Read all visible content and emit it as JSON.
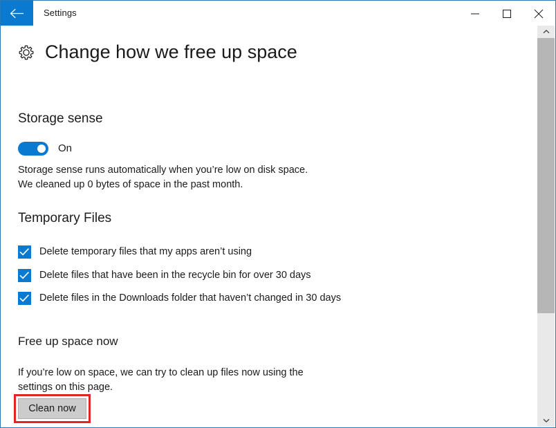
{
  "window": {
    "title": "Settings",
    "accent_color": "#0a7ad0",
    "border_color": "#2a79b5",
    "back_icon": "back-arrow-icon",
    "controls": {
      "minimize": "minimize-icon",
      "maximize": "maximize-icon",
      "close": "close-icon"
    }
  },
  "page": {
    "icon": "gear-icon",
    "title": "Change how we free up space"
  },
  "storage_sense": {
    "heading": "Storage sense",
    "toggle": {
      "label": "On",
      "state": "on",
      "color": "#0a7ad0"
    },
    "description_line_1": "Storage sense runs automatically when you’re low on disk space.",
    "description_line_2": "We cleaned up 0 bytes of space in the past month."
  },
  "temporary_files": {
    "heading": "Temporary Files",
    "checkboxes": [
      {
        "label": "Delete temporary files that my apps aren’t using",
        "checked": true
      },
      {
        "label": "Delete files that have been in the recycle bin for over 30 days",
        "checked": true
      },
      {
        "label": "Delete files in the Downloads folder that haven’t changed in 30 days",
        "checked": true
      }
    ]
  },
  "free_up_space": {
    "heading": "Free up space now",
    "description_line_1": "If you’re low on space, we can try to clean up files now using the",
    "description_line_2": "settings on this page.",
    "button_label": "Clean now",
    "highlight_color": "#e52421"
  },
  "scrollbar": {
    "up_arrow": "chevron-up-icon",
    "down_arrow": "chevron-down-icon",
    "thumb": "scrollbar-thumb",
    "track_color": "#e9e9e9",
    "thumb_color": "#b6b6b6"
  }
}
